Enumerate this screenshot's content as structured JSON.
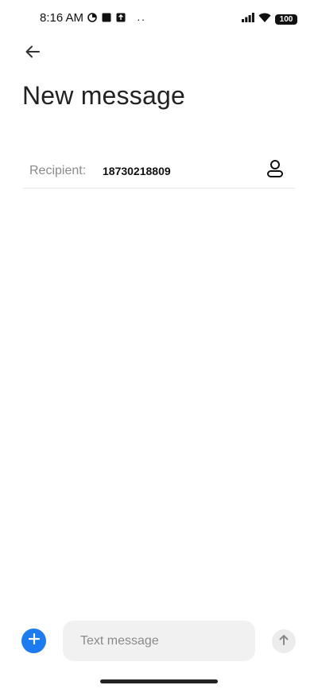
{
  "status_bar": {
    "time": "8:16 AM",
    "dots": "··",
    "battery": "100",
    "icons": [
      "data-saver-icon",
      "square-notification-icon",
      "upload-notification-icon",
      "signal-icon",
      "wifi-icon",
      "battery-icon"
    ]
  },
  "header": {
    "back_icon": "back-arrow-icon",
    "title": "New message"
  },
  "recipient": {
    "label": "Recipient:",
    "value": "18730218809",
    "contact_icon": "contact-person-icon"
  },
  "composer": {
    "add_icon": "plus-icon",
    "placeholder": "Text message",
    "send_icon": "send-arrow-up-icon"
  },
  "colors": {
    "accent": "#1a7cf0",
    "input_background": "#f1f1f1",
    "muted_text": "#8a8a8a"
  }
}
